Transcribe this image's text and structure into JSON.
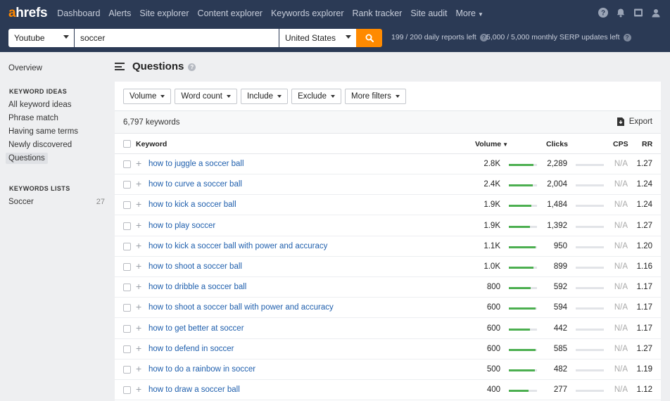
{
  "brand": {
    "logo_accent": "a",
    "logo_rest": "hrefs"
  },
  "nav": {
    "items": [
      {
        "label": "Dashboard",
        "active": false
      },
      {
        "label": "Alerts",
        "active": false
      },
      {
        "label": "Site explorer",
        "active": false
      },
      {
        "label": "Content explorer",
        "active": false
      },
      {
        "label": "Keywords explorer",
        "active": true
      },
      {
        "label": "Rank tracker",
        "active": false
      },
      {
        "label": "Site audit",
        "active": false
      },
      {
        "label": "More",
        "active": false
      }
    ],
    "icons": [
      "help-icon",
      "bell-icon",
      "screen-icon",
      "user-icon"
    ]
  },
  "search": {
    "source": "Youtube",
    "query": "soccer",
    "country": "United States",
    "daily_reports": "199 / 200 daily reports left",
    "serp_updates": "5,000 / 5,000 monthly SERP updates left"
  },
  "sidebar": {
    "overview": "Overview",
    "ideas_heading": "KEYWORD IDEAS",
    "ideas": [
      {
        "label": "All keyword ideas",
        "active": false
      },
      {
        "label": "Phrase match",
        "active": false
      },
      {
        "label": "Having same terms",
        "active": false
      },
      {
        "label": "Newly discovered",
        "active": false
      },
      {
        "label": "Questions",
        "active": true
      }
    ],
    "lists_heading": "KEYWORDS LISTS",
    "lists": [
      {
        "label": "Soccer",
        "count": "27"
      }
    ]
  },
  "page": {
    "title": "Questions"
  },
  "filters": [
    "Volume",
    "Word count",
    "Include",
    "Exclude",
    "More filters"
  ],
  "results": {
    "count_label": "6,797 keywords",
    "export_label": "Export"
  },
  "table": {
    "headers": {
      "keyword": "Keyword",
      "volume": "Volume",
      "clicks": "Clicks",
      "cps": "CPS",
      "rr": "RR"
    },
    "rows": [
      {
        "keyword": "how to juggle a soccer ball",
        "volume": "2.8K",
        "vol_fill": 0.88,
        "clicks": "2,289",
        "cps": "N/A",
        "rr": "1.27"
      },
      {
        "keyword": "how to curve a soccer ball",
        "volume": "2.4K",
        "vol_fill": 0.86,
        "clicks": "2,004",
        "cps": "N/A",
        "rr": "1.24"
      },
      {
        "keyword": "how to kick a soccer ball",
        "volume": "1.9K",
        "vol_fill": 0.8,
        "clicks": "1,484",
        "cps": "N/A",
        "rr": "1.24"
      },
      {
        "keyword": "how to play soccer",
        "volume": "1.9K",
        "vol_fill": 0.75,
        "clicks": "1,392",
        "cps": "N/A",
        "rr": "1.27"
      },
      {
        "keyword": "how to kick a soccer ball with power and accuracy",
        "volume": "1.1K",
        "vol_fill": 0.95,
        "clicks": "950",
        "cps": "N/A",
        "rr": "1.20"
      },
      {
        "keyword": "how to shoot a soccer ball",
        "volume": "1.0K",
        "vol_fill": 0.88,
        "clicks": "899",
        "cps": "N/A",
        "rr": "1.16"
      },
      {
        "keyword": "how to dribble a soccer ball",
        "volume": "800",
        "vol_fill": 0.78,
        "clicks": "592",
        "cps": "N/A",
        "rr": "1.17"
      },
      {
        "keyword": "how to shoot a soccer ball with power and accuracy",
        "volume": "600",
        "vol_fill": 0.95,
        "clicks": "594",
        "cps": "N/A",
        "rr": "1.17"
      },
      {
        "keyword": "how to get better at soccer",
        "volume": "600",
        "vol_fill": 0.75,
        "clicks": "442",
        "cps": "N/A",
        "rr": "1.17"
      },
      {
        "keyword": "how to defend in soccer",
        "volume": "600",
        "vol_fill": 0.95,
        "clicks": "585",
        "cps": "N/A",
        "rr": "1.27"
      },
      {
        "keyword": "how to do a rainbow in soccer",
        "volume": "500",
        "vol_fill": 0.92,
        "clicks": "482",
        "cps": "N/A",
        "rr": "1.19"
      },
      {
        "keyword": "how to draw a soccer ball",
        "volume": "400",
        "vol_fill": 0.7,
        "clicks": "277",
        "cps": "N/A",
        "rr": "1.12"
      }
    ]
  },
  "colors": {
    "nav_bg": "#2b3a55",
    "accent": "#ff8a00",
    "link": "#1f5fad",
    "bar_green": "#4caf50"
  }
}
